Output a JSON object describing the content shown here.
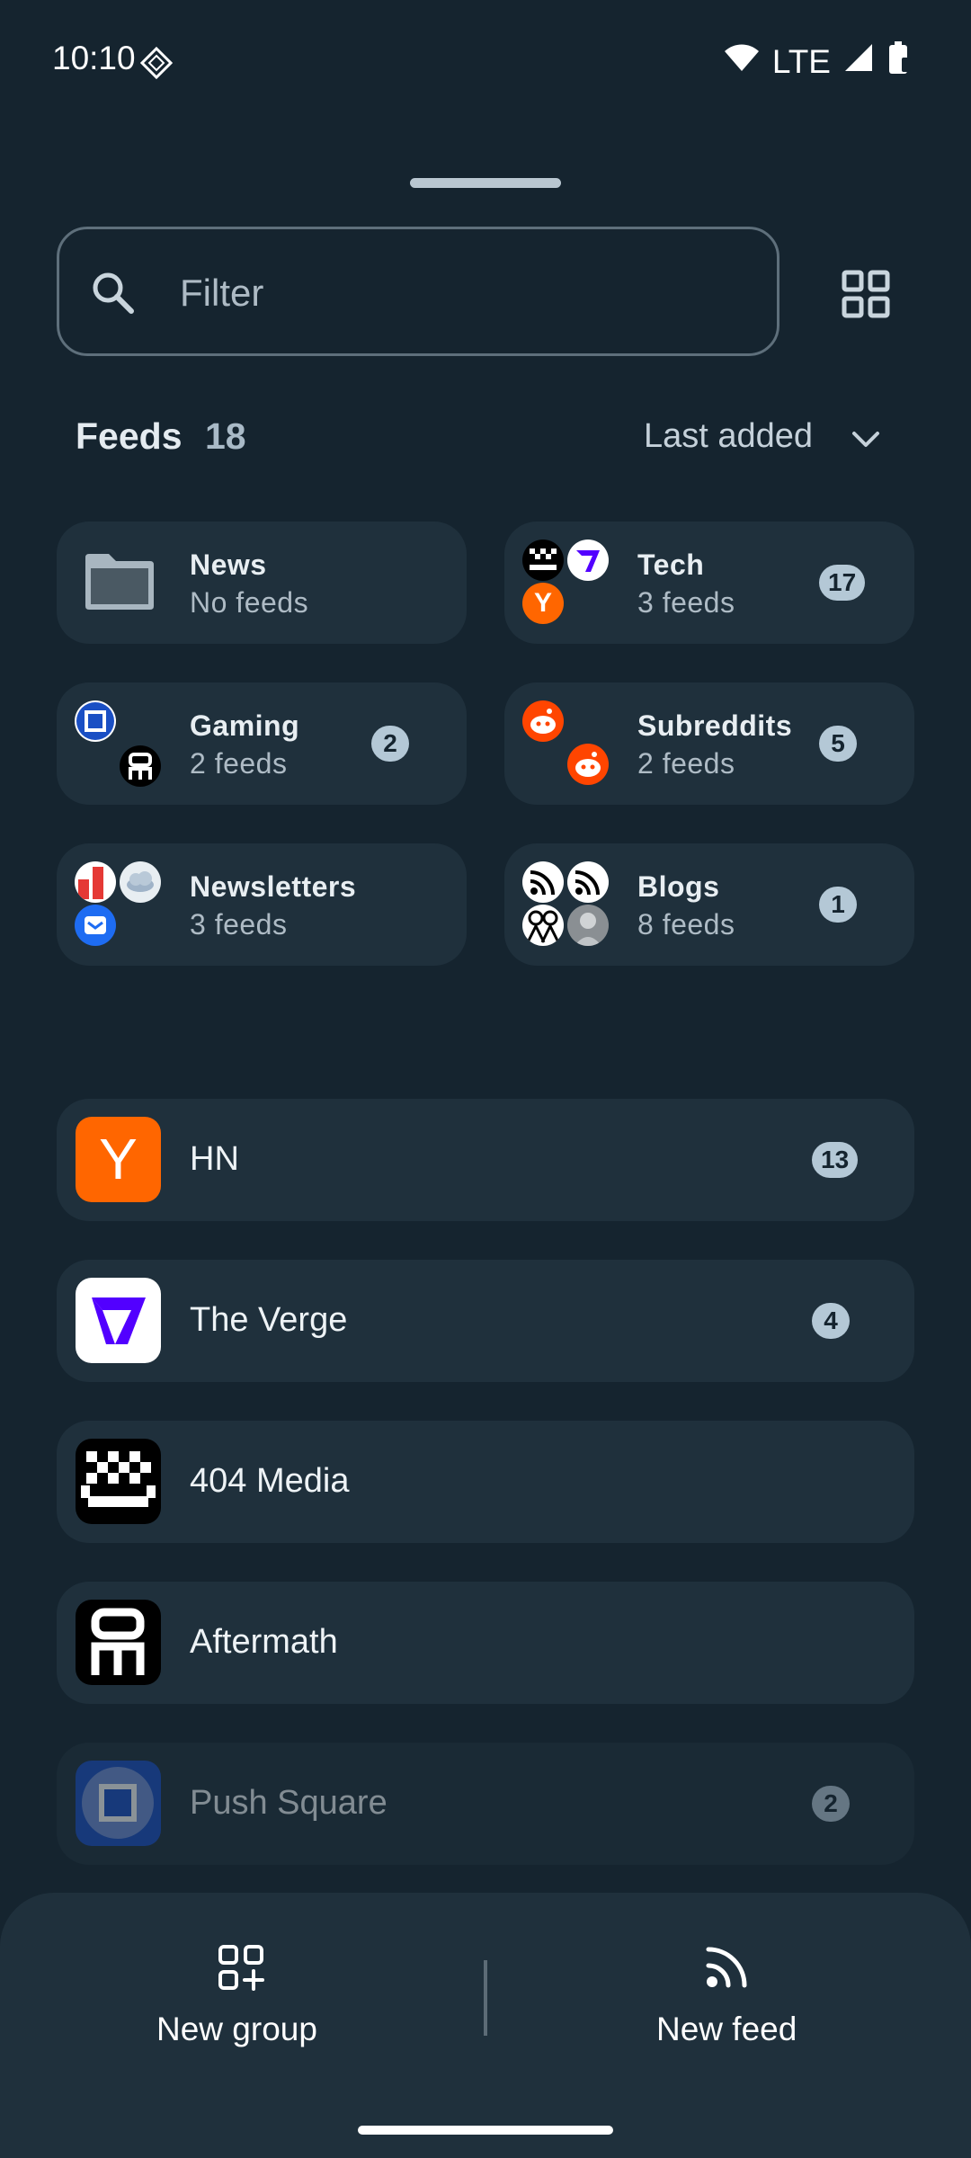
{
  "status_bar": {
    "time": "10:10",
    "network": "LTE"
  },
  "search": {
    "placeholder": "Filter"
  },
  "header": {
    "title": "Feeds",
    "count": "18",
    "sort_label": "Last added"
  },
  "groups": [
    {
      "title": "News",
      "subtitle": "No feeds",
      "badge": ""
    },
    {
      "title": "Tech",
      "subtitle": "3 feeds",
      "badge": "17"
    },
    {
      "title": "Gaming",
      "subtitle": "2 feeds",
      "badge": "2"
    },
    {
      "title": "Subreddits",
      "subtitle": "2 feeds",
      "badge": "5"
    },
    {
      "title": "Newsletters",
      "subtitle": "3 feeds",
      "badge": ""
    },
    {
      "title": "Blogs",
      "subtitle": "8 feeds",
      "badge": "1"
    }
  ],
  "feeds": [
    {
      "title": "HN",
      "badge": "13",
      "icon_letter": "Y"
    },
    {
      "title": "The Verge",
      "badge": "4"
    },
    {
      "title": "404 Media",
      "badge": ""
    },
    {
      "title": "Aftermath",
      "badge": ""
    },
    {
      "title": "Push Square",
      "badge": "2"
    }
  ],
  "bottom_bar": {
    "new_group_label": "New group",
    "new_feed_label": "New feed"
  },
  "colors": {
    "background": "#15242f",
    "card": "#1f303c",
    "badge": "#b4c8d6",
    "hn_orange": "#ff6600",
    "verge_purple": "#5200ff",
    "reddit_orange": "#ff4500"
  }
}
